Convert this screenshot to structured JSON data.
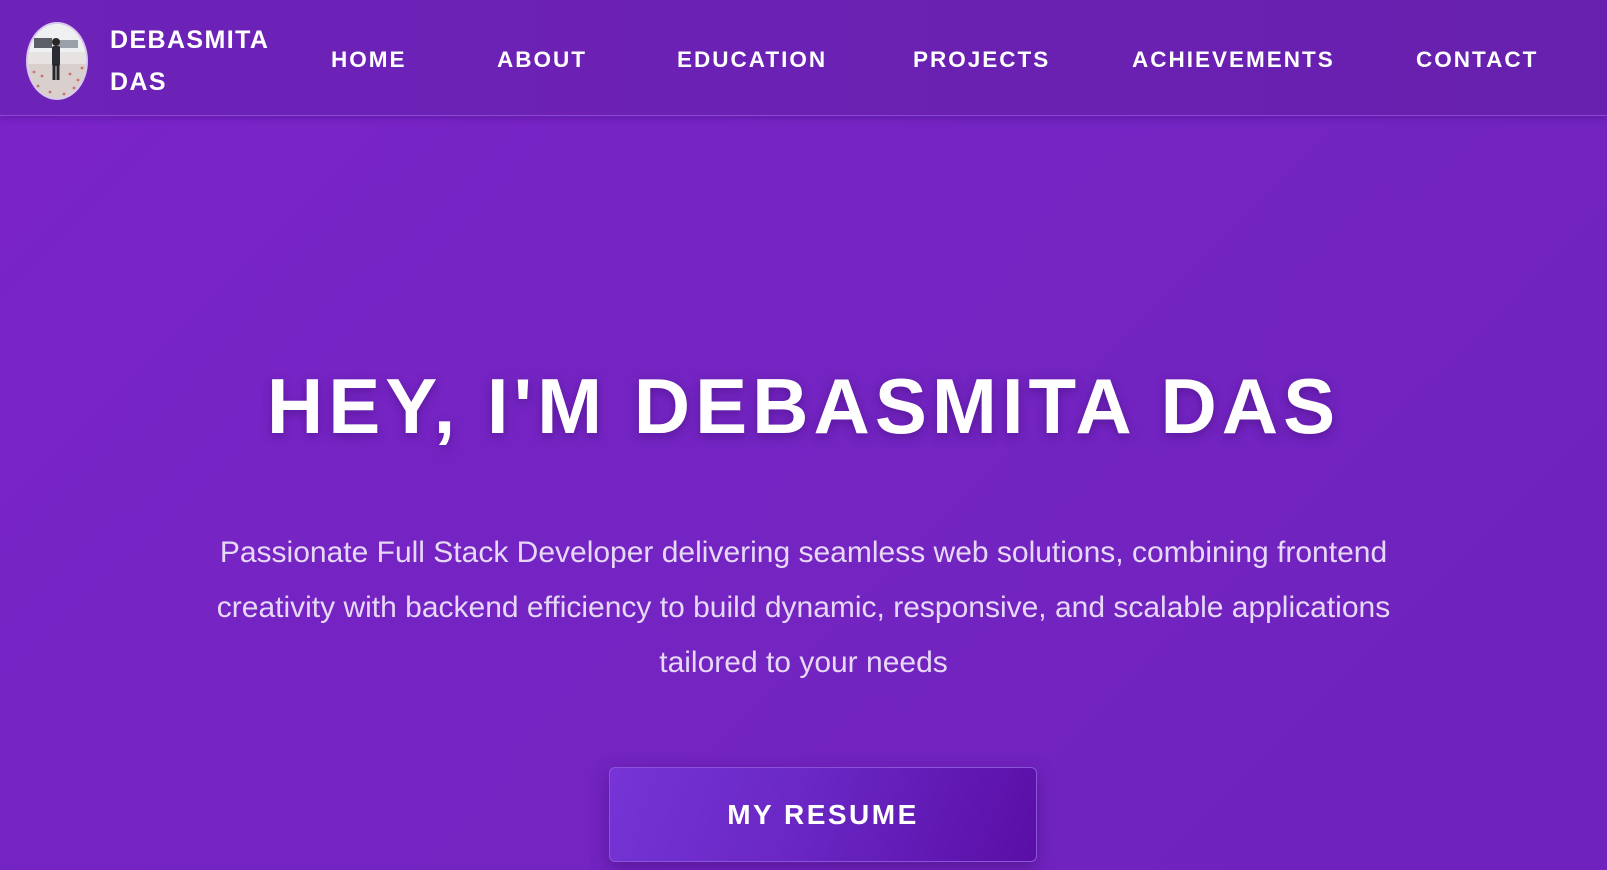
{
  "brand": {
    "name": "DEBASMITA DAS",
    "avatar_alt": "profile-photo"
  },
  "nav": {
    "items": [
      {
        "label": "HOME"
      },
      {
        "label": "ABOUT"
      },
      {
        "label": "EDUCATION"
      },
      {
        "label": "PROJECTS"
      },
      {
        "label": "ACHIEVEMENTS"
      },
      {
        "label": "CONTACT"
      }
    ]
  },
  "hero": {
    "title": "HEY, I'M DEBASMITA DAS",
    "subtitle": "Passionate Full Stack Developer delivering seamless web solutions, combining frontend creativity with backend efficiency to build dynamic, responsive, and scalable applications tailored to your needs",
    "resume_label": "MY RESUME"
  },
  "colors": {
    "background": "#7424c2",
    "header": "#6b21b3",
    "button": "#6a27c4",
    "text": "#ffffff",
    "subtitle": "#e7d8f7"
  }
}
